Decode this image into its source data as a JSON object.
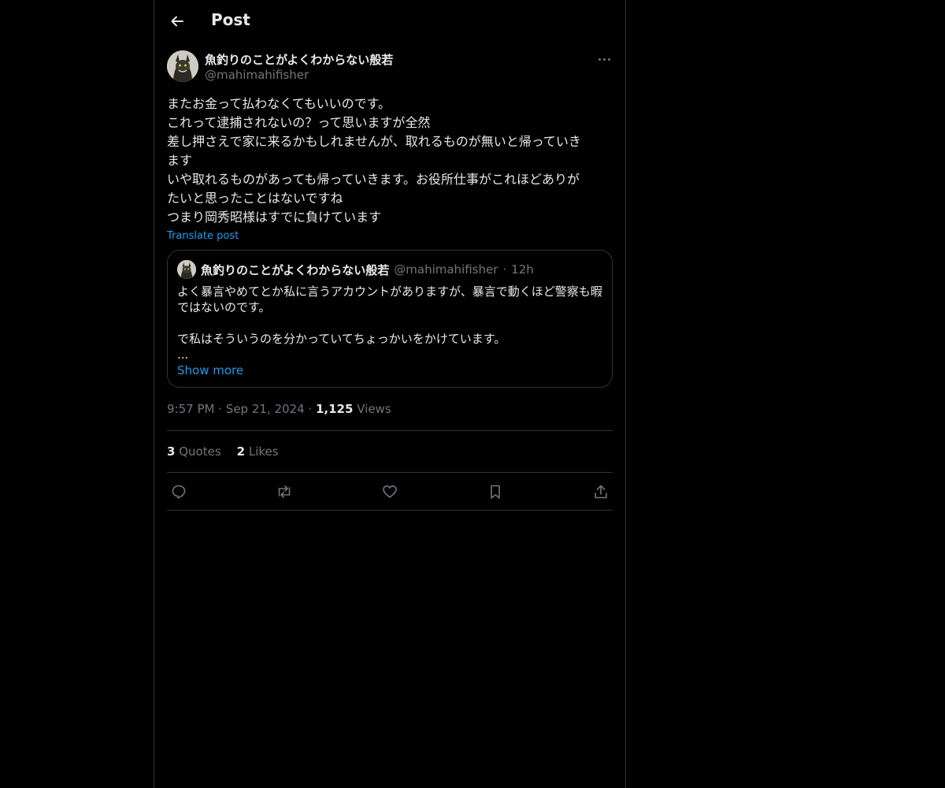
{
  "header": {
    "title": "Post"
  },
  "author": {
    "name": "魚釣りのことがよくわからない般若",
    "handle": "@mahimahifisher"
  },
  "post": {
    "lines": [
      "またお金って払わなくてもいいのです。",
      "これって逮捕されないの？って思いますが全然",
      "差し押さえで家に来るかもしれませんが、取れるものが無いと帰っていき",
      "ます",
      "いや取れるものがあっても帰っていきます。お役所仕事がこれほどありが",
      "たいと思ったことはないですね",
      "つまり岡秀昭様はすでに負けています"
    ],
    "translate_label": "Translate post"
  },
  "quote": {
    "name": "魚釣りのことがよくわからない般若",
    "handle": "@mahimahifisher",
    "dot": "·",
    "time": "12h",
    "lines": [
      "よく暴言やめてとか私に言うアカウントがありますが、暴言で動くほど警察も暇",
      "ではないのです。",
      "",
      "で私はそういうのを分かっていてちょっかいをかけています。",
      "..."
    ],
    "show_more": "Show more"
  },
  "meta": {
    "time": "9:57 PM",
    "date": "Sep 21, 2024",
    "views_count": "1,125",
    "views_label": "Views",
    "sep": "·"
  },
  "stats": {
    "quotes_count": "3",
    "quotes_label": "Quotes",
    "likes_count": "2",
    "likes_label": "Likes"
  },
  "icons": {
    "back": "arrow-left-icon",
    "more": "more-icon",
    "reply": "reply-icon",
    "repost": "repost-icon",
    "like": "heart-icon",
    "bookmark": "bookmark-icon",
    "share": "share-icon"
  },
  "colors": {
    "background": "#000000",
    "text": "#e7e9ea",
    "muted": "#71767b",
    "accent": "#1d9bf0",
    "border": "#2f3336"
  }
}
